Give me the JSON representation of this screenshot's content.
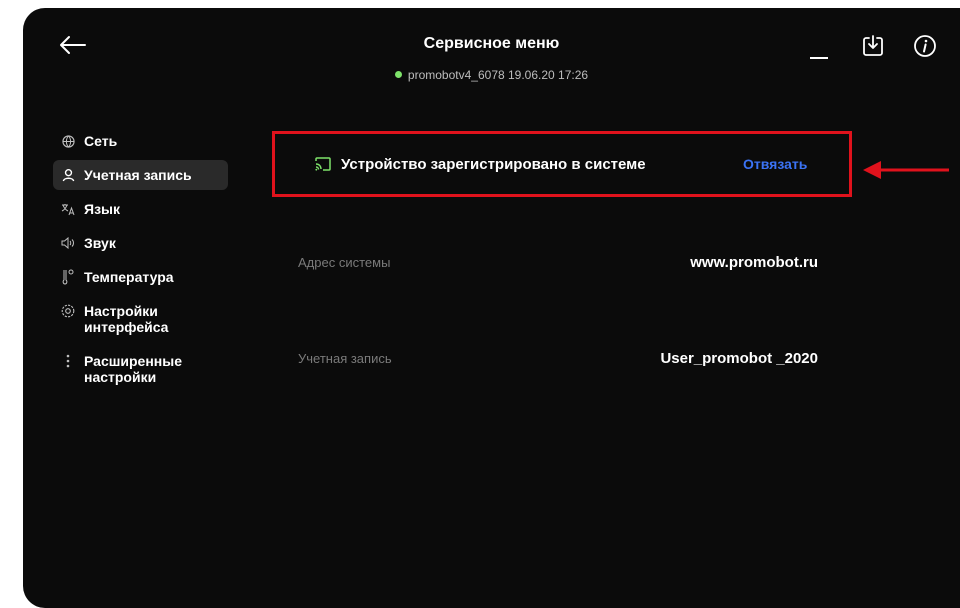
{
  "header": {
    "title": "Сервисное меню",
    "status": "promobotv4_6078 19.06.20  17:26",
    "status_color": "#7ee36a"
  },
  "toolbar": {
    "back_icon": "arrow-left-icon",
    "minimize_icon": "minimize-icon",
    "download_icon": "download-icon",
    "info_icon": "info-icon"
  },
  "sidebar": {
    "items": [
      {
        "label": "Сеть",
        "icon": "globe-icon"
      },
      {
        "label": "Учетная запись",
        "icon": "user-icon",
        "active": true
      },
      {
        "label": "Язык",
        "icon": "translate-icon"
      },
      {
        "label": "Звук",
        "icon": "speaker-icon"
      },
      {
        "label": "Температура",
        "icon": "thermometer-icon"
      },
      {
        "label": "Настройки интерфейса",
        "icon": "settings-icon"
      },
      {
        "label": "Расширенные настройки",
        "icon": "more-vertical-icon"
      }
    ]
  },
  "registration": {
    "status_text": "Устройство зарегистрировано в системе",
    "unbind_label": "Отвязать",
    "status_icon": "cast-icon",
    "highlight_color": "#e0121c",
    "link_color": "#3b73f5"
  },
  "fields": [
    {
      "label": "Адрес системы",
      "value": "www.promobot.ru"
    },
    {
      "label": "Учетная запись",
      "value": "User_promobot _2020"
    }
  ],
  "annotation": {
    "arrow_color": "#e0121c"
  }
}
